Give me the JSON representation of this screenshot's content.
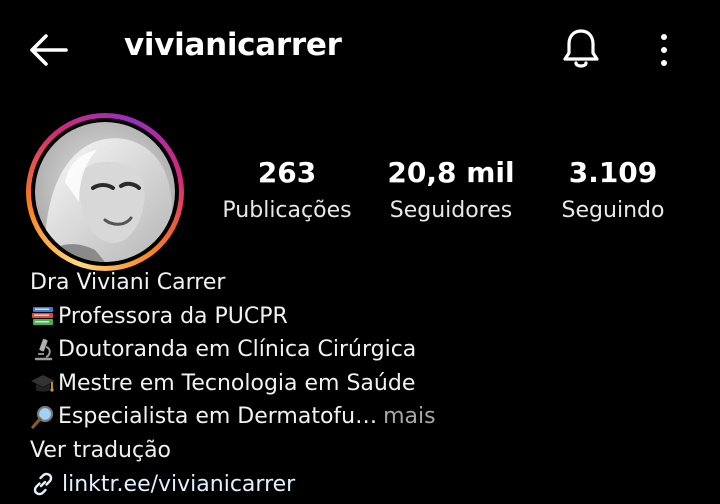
{
  "header": {
    "username": "vivianicarrer"
  },
  "stats": {
    "posts": {
      "value": "263",
      "label": "Publicações"
    },
    "followers": {
      "value": "20,8 mil",
      "label": "Seguidores"
    },
    "following": {
      "value": "3.109",
      "label": "Seguindo"
    }
  },
  "bio": {
    "name": "Dra Viviani Carrer",
    "lines": [
      {
        "icon": "books-icon",
        "text": "Professora da PUCPR"
      },
      {
        "icon": "microscope-icon",
        "text": "Doutoranda em Clínica Cirúrgica"
      },
      {
        "icon": "graduation-cap-icon",
        "text": "Mestre em Tecnologia em Saúde"
      },
      {
        "icon": "magnifying-glass-icon",
        "text": "Especialista em Dermatofu…"
      }
    ],
    "more_label": "mais",
    "translate_label": "Ver tradução",
    "link_text": "linktr.ee/vivianicarrer"
  },
  "colors": {
    "background": "#000000",
    "text": "#f5f5f5",
    "muted": "#a8a8a8",
    "link": "#e0f1ff",
    "story_ring": [
      "#feda75",
      "#fa7e1e",
      "#d62976",
      "#962fbf"
    ]
  }
}
